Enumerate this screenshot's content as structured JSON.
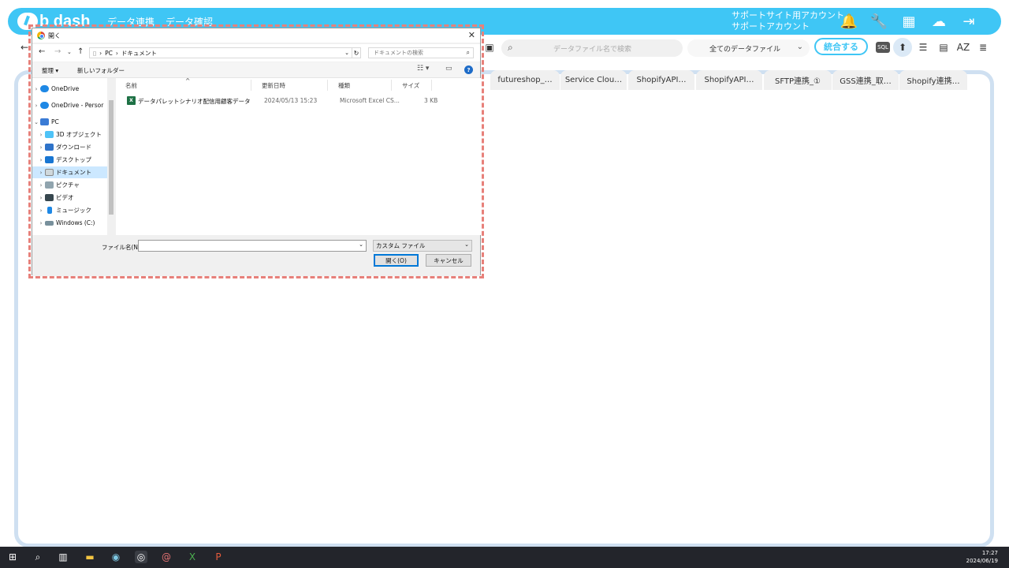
{
  "app": {
    "logo_text": "b dash",
    "nav": [
      "データ連携",
      "データ確認"
    ],
    "account_line1": "サポートサイト用アカウント",
    "account_line2": "サポートアカウント",
    "icons": [
      "bell-icon",
      "wrench-icon",
      "grid-icon",
      "az-cloud-icon",
      "logout-icon"
    ]
  },
  "toolbar": {
    "search_placeholder": "データファイル名で検索",
    "filter_value": "全てのデータファイル",
    "merge_label": "統合する",
    "sql_label": "SQL"
  },
  "tabs": [
    "futureshop_…",
    "Service Clou…",
    "ShopifyAPI…",
    "ShopifyAPI…",
    "SFTP連携_①",
    "GSS連携_取…",
    "Shopify連携…"
  ],
  "dialog": {
    "title": "開く",
    "path": [
      "PC",
      "ドキュメント"
    ],
    "search_placeholder": "ドキュメントの検索",
    "organize_label": "整理 ▾",
    "new_folder_label": "新しいフォルダー",
    "nav_items": [
      {
        "label": "OneDrive",
        "icon": "onedrive-icon"
      },
      {
        "label": "OneDrive - Persor",
        "icon": "onedrive-icon"
      },
      {
        "label": "PC",
        "icon": "pc-icon"
      },
      {
        "label": "3D オブジェクト",
        "icon": "3d-objects-icon"
      },
      {
        "label": "ダウンロード",
        "icon": "download-icon"
      },
      {
        "label": "デスクトップ",
        "icon": "desktop-icon"
      },
      {
        "label": "ドキュメント",
        "icon": "documents-icon"
      },
      {
        "label": "ピクチャ",
        "icon": "pictures-icon"
      },
      {
        "label": "ビデオ",
        "icon": "video-icon"
      },
      {
        "label": "ミュージック",
        "icon": "music-icon"
      },
      {
        "label": "Windows (C:)",
        "icon": "drive-icon"
      }
    ],
    "columns": {
      "name": "名前",
      "date": "更新日時",
      "type": "種類",
      "size": "サイズ"
    },
    "files": [
      {
        "name": "データパレットシナリオ配信用顧客データ",
        "date": "2024/05/13 15:23",
        "type": "Microsoft Excel CS...",
        "size": "3 KB"
      }
    ],
    "filename_label": "ファイル名(N):",
    "filename_value": "",
    "filetype_value": "カスタム ファイル",
    "open_label": "開く(O)",
    "cancel_label": "キャンセル"
  },
  "taskbar": {
    "time": "17:27",
    "date": "2024/06/19"
  }
}
